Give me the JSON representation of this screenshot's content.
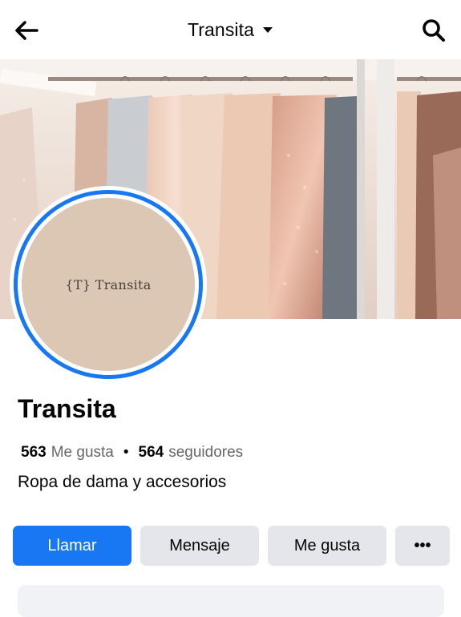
{
  "header": {
    "title": "Transita",
    "back_icon": "arrow-left-icon",
    "dropdown_icon": "caret-down-icon",
    "search_icon": "search-icon"
  },
  "cover": {
    "description_icon": "clothing-rack-photo"
  },
  "avatar": {
    "logo_mark": "{T}",
    "logo_text": "Transita",
    "ring_color": "#1877f2"
  },
  "profile": {
    "name": "Transita",
    "likes_count": "563",
    "likes_label": "Me gusta",
    "separator": "•",
    "followers_count": "564",
    "followers_label": "seguidores",
    "category": "Ropa de dama y accesorios"
  },
  "actions": {
    "call_label": "Llamar",
    "message_label": "Mensaje",
    "like_label": "Me gusta",
    "more_label": "•••"
  },
  "colors": {
    "primary": "#1877f2",
    "secondary_button": "#e4e6eb",
    "muted_text": "#65676b"
  }
}
